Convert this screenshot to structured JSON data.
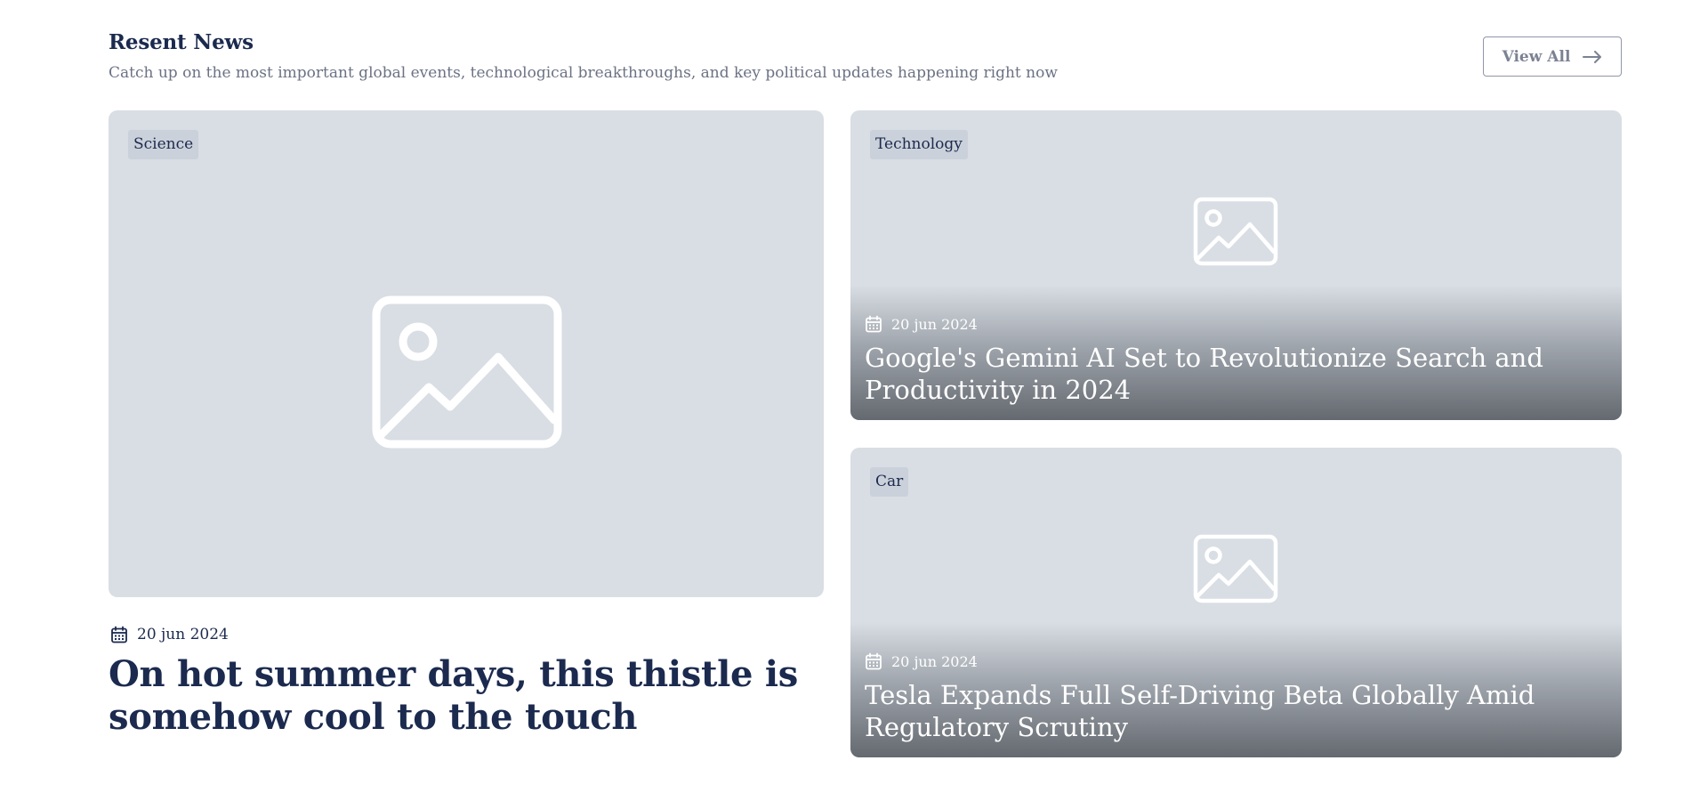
{
  "header": {
    "title": "Resent News",
    "subtitle": "Catch up on the most important global events, technological breakthroughs, and key political updates happening right now",
    "view_all_label": "View All"
  },
  "featured": {
    "category": "Science",
    "date": "20 jun 2024",
    "title": "On hot summer days, this thistle is somehow cool to the touch"
  },
  "side_articles": [
    {
      "category": "Technology",
      "date": "20 jun 2024",
      "title": "Google's Gemini AI Set to Revolutionize Search and Productivity in 2024"
    },
    {
      "category": "Car",
      "date": "20 jun 2024",
      "title": "Tesla Expands Full Self-Driving Beta Globally Amid Regulatory Scrutiny"
    }
  ],
  "icons": {
    "arrow": "arrow-right-icon",
    "calendar": "calendar-icon",
    "image": "image-placeholder-icon"
  },
  "colors": {
    "heading": "#1b2a4e",
    "muted": "#6b7283",
    "card_bg": "#d9dee4",
    "tag_bg": "#cbd1da"
  }
}
